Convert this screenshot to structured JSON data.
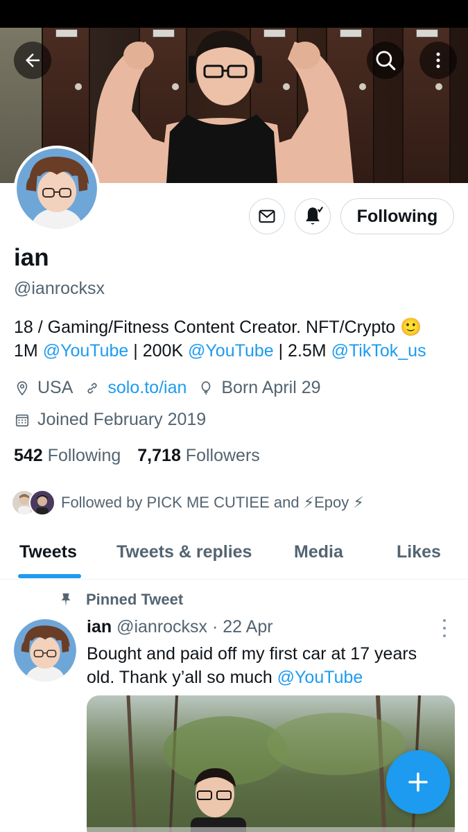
{
  "profile": {
    "name": "ian",
    "handle": "@ianrocksx",
    "bio_line1_text": "18 / Gaming/Fitness Content Creator. NFT/Crypto 🙂",
    "bio_line2": {
      "p1": "1M ",
      "l1": "@YouTube",
      "p2": " | 200K ",
      "l2": "@YouTube",
      "p3": " | 2.5M ",
      "l3": "@TikTok_us"
    },
    "location": "USA",
    "website": "solo.to/ian",
    "birthday": "Born April 29",
    "joined": "Joined February 2019",
    "following_count": "542",
    "following_label": "Following",
    "followers_count": "7,718",
    "followers_label": "Followers",
    "followed_by": "Followed by PICK ME CUTIEE and ⚡Epoy ⚡"
  },
  "actions": {
    "following_button": "Following"
  },
  "tabs": [
    {
      "label": "Tweets",
      "active": true
    },
    {
      "label": "Tweets & replies",
      "active": false
    },
    {
      "label": "Media",
      "active": false
    },
    {
      "label": "Likes",
      "active": false
    }
  ],
  "pinned_tweet": {
    "pinned_label": "Pinned Tweet",
    "author_name": "ian",
    "author_handle_date": "@ianrocksx · 22 Apr",
    "text_part1": "Bought and paid off my first car at 17 years old. Thank y’all so much ",
    "text_link": "@YouTube"
  },
  "colors": {
    "accent": "#1d9bf0",
    "secondary_text": "#536471",
    "primary_text": "#0f1419",
    "border": "#cfd9de"
  },
  "icons": {
    "back": "arrow-left-icon",
    "search": "search-icon",
    "more": "more-vertical-icon",
    "message": "envelope-icon",
    "notifications": "bell-icon",
    "location": "location-pin-icon",
    "website": "link-icon",
    "birthday": "balloon-icon",
    "joined": "calendar-icon",
    "pin": "pin-icon",
    "compose": "plus-icon"
  }
}
